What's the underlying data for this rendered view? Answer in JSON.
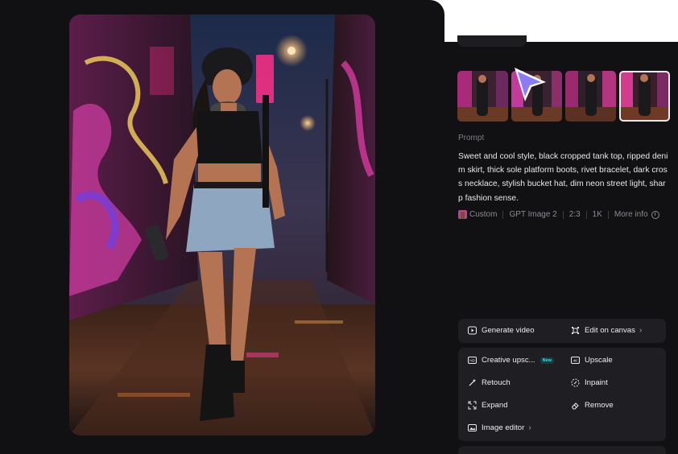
{
  "prompt": {
    "label": "Prompt",
    "text": "Sweet and cool style, black cropped tank top, ripped denim skirt, thick sole platform boots, rivet bracelet, dark cross necklace, stylish bucket hat, dim neon street light, sharp fashion sense."
  },
  "meta": {
    "style": "Custom",
    "model": "GPT Image 2",
    "ratio": "2:3",
    "resolution": "1K",
    "more_info": "More info"
  },
  "actions": {
    "generate_video": "Generate video",
    "edit_on_canvas": "Edit on canvas",
    "creative_upscale": "Creative upsc...",
    "new_badge": "New",
    "upscale": "Upscale",
    "retouch": "Retouch",
    "inpaint": "Inpaint",
    "expand": "Expand",
    "remove": "Remove",
    "image_editor": "Image editor"
  },
  "thumbnails": {
    "count_visible": 4,
    "selected": 4
  },
  "icons": {
    "cursor": "pointer-cursor-icon",
    "info": "info-icon"
  },
  "colors": {
    "panel_bg": "#111113",
    "card_bg": "#1f1f23",
    "cursor": "#8b7cf6",
    "neon_pink": "#e8338f",
    "badge": "#4ed6e6"
  }
}
